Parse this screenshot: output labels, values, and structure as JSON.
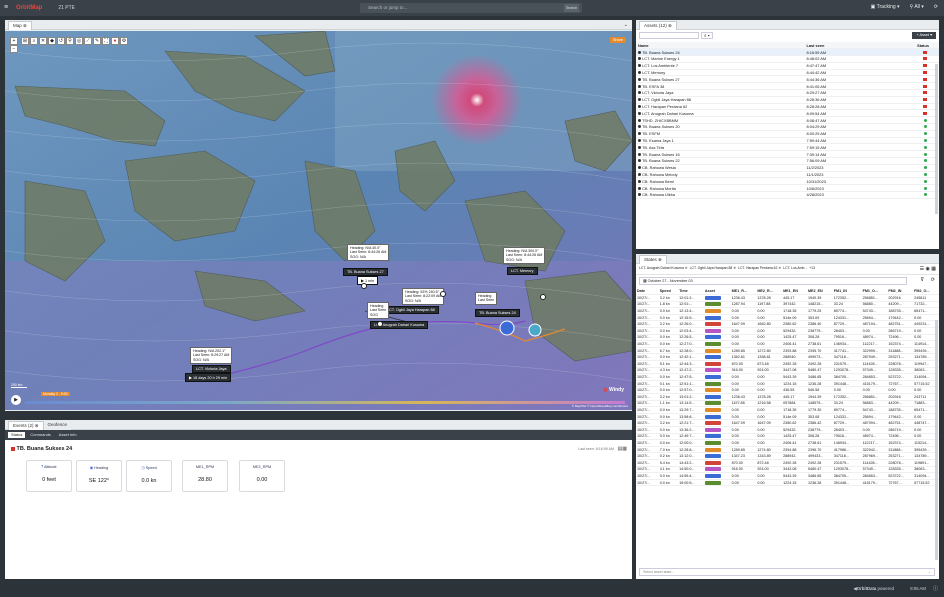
{
  "topbar": {
    "title": "OrbitMap",
    "fleet": "21 PTE",
    "search_placeholder": "Search or jump to...",
    "search_btn": "Search",
    "tracking": "Tracking",
    "all": "All"
  },
  "map": {
    "tab": "Map",
    "share": "Share",
    "windy": "Windy",
    "scale": "250 km",
    "timeline": "Monday 2 - 9:00",
    "attribution": "© MapTiler © OpenStreetMap contributors"
  },
  "callouts": [
    {
      "lines": [
        "Heading: N/A 40.0°",
        "Last Seen: 8:44:26 AM",
        "SOG: N/A"
      ],
      "label": "TB. Buana Sukses 27",
      "eta": "1 min"
    },
    {
      "lines": [
        "Heading: 53% 240.6°",
        "Last Seen: 8:22:09 AM",
        "SOG: N/A"
      ],
      "label": "LCT. Ogbli Jaya Harapan 88"
    },
    {
      "lines": [
        "Heading: N/A 300.0°",
        "Last Seen: 8:44:26 AM",
        "SOG: N/A"
      ],
      "label": "LCT. Memory"
    },
    {
      "lines": [
        "Heading",
        "Last Seen",
        "SOG"
      ],
      "label": "LCT. Anugrah Dahari Kusuma"
    },
    {
      "lines": [
        "Heading",
        "Last Seen"
      ],
      "label": "TB. Buana Sukses 24"
    },
    {
      "lines": [
        "Heading: N/A 202.1°",
        "Last Seen: 8:29:27 AM",
        "SOG: N/A"
      ],
      "label": "LCT. Victoria Jaya",
      "eta": "18 days 20 h 29 min"
    }
  ],
  "assets": {
    "tab": "Assets (12)",
    "add": "Asset",
    "cols": [
      "Name",
      "Last seen",
      "Status"
    ],
    "rows": [
      [
        "TB. Buana Sukses 24",
        "8:16:59 AM",
        "red"
      ],
      [
        "LCT. Marine Energy 1",
        "8:48:02 AM",
        "red"
      ],
      [
        "LCT. Los Ambiente 7",
        "8:47:47 AM",
        "red"
      ],
      [
        "LCT. Memory",
        "8:44:42 AM",
        "red"
      ],
      [
        "TB. Buana Sukses 27",
        "8:44:36 AM",
        "red"
      ],
      [
        "TB. ESFA 38",
        "8:41:05 AM",
        "red"
      ],
      [
        "LCT. Victoria Jaya",
        "8:29:27 AM",
        "red"
      ],
      [
        "LCT. Ogbli Jaya Harapan 88",
        "8:28:36 AM",
        "red"
      ],
      [
        "LCT. Harapan Perdana 62",
        "8:28:28 AM",
        "red"
      ],
      [
        "LCT. Anugrah Dahari Kusuma",
        "8:09:54 AM",
        "red"
      ],
      [
        "TSHD. ZHICXBBMM",
        "8:08:47 AM",
        "green"
      ],
      [
        "TB. Buana Sukses 20",
        "8:04:29 AM",
        "green"
      ],
      [
        "TB. ESFM",
        "8:00:25 AM",
        "green"
      ],
      [
        "TB. Esama Jaya 1",
        "7:59:44 AM",
        "green"
      ],
      [
        "TB. Ass Tirta",
        "7:59:15 AM",
        "green"
      ],
      [
        "TB. Buana Sukses 16",
        "7:39:14 AM",
        "green"
      ],
      [
        "TB. Buana Sukses 22",
        "7:56:09 AM",
        "green"
      ],
      [
        "CB. Rahowa Wesia",
        "11/2/2023",
        "green"
      ],
      [
        "CB. Rahowa Melody",
        "11/1/2023",
        "green"
      ],
      [
        "CB. Rahowa Bemi",
        "10/31/2023",
        "green"
      ],
      [
        "CB. Rahowa Morita",
        "10/6/2023",
        "green"
      ],
      [
        "CB. Rahowa Ulirka",
        "4/28/2023",
        "green"
      ]
    ]
  },
  "states": {
    "tab": "States",
    "chips": [
      "LCT. Anugrah Dahari Kusuma",
      "LCT. Ogbli Jaya Harapan 88",
      "LCT. Harapan Perdana 62",
      "LCT. Los Amb..."
    ],
    "chips_more": "+13",
    "date": "October 27 - November 03",
    "cols": [
      "Date",
      "Speed",
      "Time",
      "Asset",
      "ME1_R...",
      "ME2_R...",
      "ME1_EN",
      "ME2_EN",
      "FM1_IN",
      "FM1_O...",
      "FM2_IN",
      "FM2_O..."
    ],
    "rows": [
      [
        "10/27/...",
        "3.2 kn",
        "12:01:2...",
        "#3b6bd6",
        "1236.43",
        "1378.28",
        "445.17",
        "1940.39",
        "172352...",
        "256851...",
        "202916",
        "245811"
      ],
      [
        "10/27/...",
        "1.8 kn",
        "12:01:...",
        "#5b8c2e",
        "1287.94",
        "1197.88",
        "397442.",
        "148215...",
        "33.24",
        "56880...",
        "44209...",
        "71732..."
      ],
      [
        "10/27/...",
        "0.0 kn",
        "12:13:4...",
        "#e08a2a",
        "0.00",
        "0.00",
        "1718.35",
        "1779.25",
        "89774...",
        "54743...",
        "188735...",
        "65471..."
      ],
      [
        "10/27/...",
        "0.0 kn",
        "12:15:5...",
        "#3b6bd6",
        "0.00",
        "0.00",
        "514e.09",
        "353.09",
        "124331...",
        "25694...",
        "179442...",
        "0.00"
      ],
      [
        "10/27/...",
        "3.2 kn",
        "12:26:0...",
        "#d2443a",
        "1647.09",
        "1662.80",
        "2380.62",
        "2386.40",
        "87729...",
        "487194...",
        "482751...",
        "449231..."
      ],
      [
        "10/27/...",
        "0.0 kn",
        "12:03:4...",
        "#b855c4",
        "0.00",
        "0.00",
        "529432.",
        "238779...",
        "28403...",
        "0.00",
        "286719...",
        "0.00"
      ],
      [
        "10/27/...",
        "0.0 kn",
        "12:26:5...",
        "#3b6bd6",
        "0.00",
        "0.00",
        "1425.47",
        "308.28",
        "79516...",
        "48974...",
        "72496...",
        "0.00"
      ],
      [
        "10/27/...",
        "0.0 kn",
        "12:27:0...",
        "#5b8c2e",
        "0.00",
        "0.00",
        "2406.41",
        "2738.61",
        "146934...",
        "112217...",
        "152374...",
        "114914..."
      ],
      [
        "10/27/...",
        "6.7 kn",
        "12:28:0...",
        "#e08a2a",
        "1289.85",
        "1272.80",
        "2393.88",
        "2395.70",
        "417741...",
        "322999...",
        "311888...",
        "395439..."
      ],
      [
        "10/27/...",
        "0.0 kn",
        "12:42:1...",
        "#3b6bd6",
        "1362.81",
        "1358.81",
        "288940.",
        "499073...",
        "347118...",
        "287949...",
        "253271...",
        "134789..."
      ],
      [
        "10/27/...",
        "5.1 kn",
        "12:44:3...",
        "#d2443a",
        "870.00",
        "873.48",
        "2492.28",
        "2492.28",
        "231579...",
        "114428...",
        "228078...",
        "119947..."
      ],
      [
        "10/27/...",
        "4.3 kn",
        "12:47:2...",
        "#b855c4",
        "916.00",
        "924.00",
        "3447.08",
        "5480.47",
        "1293078...",
        "57349...",
        "128335...",
        "38063..."
      ],
      [
        "10/27/...",
        "0.0 kn",
        "12:47:5...",
        "#3b6bd6",
        "0.00",
        "0.00",
        "5443.39",
        "3486.65",
        "384705...",
        "284653...",
        "523722...",
        "314094..."
      ],
      [
        "10/27/...",
        "0.1 kn",
        "12:51:1...",
        "#5b8c2e",
        "0.00",
        "0.00",
        "1224.15",
        "1236.28",
        "391448...",
        "415179...",
        "72767...",
        "57715.52"
      ],
      [
        "10/27/...",
        "0.0 kn",
        "12:57:0...",
        "#e08a2a",
        "0.00",
        "0.00",
        "436.55",
        "546.58",
        "0.00",
        "0.00",
        "0.00",
        "0.00"
      ],
      [
        "10/27/...",
        "3.2 kn",
        "13:01:2...",
        "#3b6bd6",
        "1236.43",
        "1378.28",
        "445.17",
        "1944.39",
        "172352...",
        "256851...",
        "202916",
        "243711"
      ],
      [
        "10/27/...",
        "1.1 kn",
        "13:14:5...",
        "#5b8c2e",
        "1197.88",
        "1216.58",
        "057884.",
        "148575...",
        "33.24",
        "56863...",
        "44209...",
        "71883..."
      ],
      [
        "10/27/...",
        "0.0 kn",
        "13:29:7...",
        "#e08a2a",
        "0.00",
        "0.00",
        "1718.35",
        "1779.30",
        "89774...",
        "54743...",
        "188735...",
        "65471..."
      ],
      [
        "10/27/...",
        "0.0 kn",
        "13:58:8...",
        "#3b6bd6",
        "0.00",
        "0.00",
        "514e.09",
        "353.08",
        "124331...",
        "25694...",
        "179442...",
        "0.00"
      ],
      [
        "10/27/...",
        "3.2 kn",
        "12:21:7...",
        "#d2443a",
        "1647.09",
        "1647.09",
        "2380.62",
        "2386.42",
        "87729...",
        "487094...",
        "482751...",
        "448747..."
      ],
      [
        "10/27/...",
        "0.0 kn",
        "13:36:2...",
        "#b855c4",
        "0.00",
        "0.00",
        "529432.",
        "238779...",
        "28403...",
        "0.00",
        "286719...",
        "0.00"
      ],
      [
        "10/27/...",
        "0.0 kn",
        "12:49:7...",
        "#3b6bd6",
        "0.00",
        "0.00",
        "1425.47",
        "308.28",
        "79516...",
        "48974...",
        "72496...",
        "0.00"
      ],
      [
        "10/27/...",
        "0.0 kn",
        "12:00:0...",
        "#5b8c2e",
        "0.00",
        "0.00",
        "2406.41",
        "2738.61",
        "146934...",
        "112217...",
        "152374...",
        "115214..."
      ],
      [
        "10/27/...",
        "7.0 kn",
        "12:28:8...",
        "#e08a2a",
        "1289.85",
        "1274.80",
        "2394.88",
        "2396.70",
        "417986...",
        "322942...",
        "311888...",
        "395439..."
      ],
      [
        "10/27/...",
        "0.2 kn",
        "13:12:0...",
        "#3b6bd6",
        "1347.23",
        "1343.89",
        "288942.",
        "499433...",
        "347118...",
        "287969...",
        "253271...",
        "134789..."
      ],
      [
        "10/27/...",
        "5.4 kn",
        "14:43:2...",
        "#d2443a",
        "870.00",
        "872.48",
        "2492.28",
        "2492.28",
        "231579...",
        "114428...",
        "228078...",
        "119891..."
      ],
      [
        "10/27/...",
        "4.1 kn",
        "14:50:0...",
        "#b855c4",
        "916.00",
        "924.00",
        "3443.08",
        "5480.47",
        "1293078...",
        "57349...",
        "128335...",
        "38063..."
      ],
      [
        "10/27/...",
        "0.0 kn",
        "14:55:4...",
        "#3b6bd6",
        "0.00",
        "0.00",
        "5443.39",
        "3486.65",
        "384705...",
        "284653...",
        "523722...",
        "314094..."
      ],
      [
        "10/27/...",
        "0.0 kn",
        "15:00:5...",
        "#5b8c2e",
        "0.00",
        "0.00",
        "1224.15",
        "1236.28",
        "391448...",
        "415179...",
        "72767...",
        "57715.52"
      ]
    ],
    "footer_select": "Select asset state..."
  },
  "events": {
    "tabs": [
      "Events (2)",
      "Geofence"
    ],
    "subtabs": [
      "Status",
      "Commands",
      "Asset Info"
    ],
    "vessel": "TB. Buana Sukses 24",
    "last_seen": "Last seen: 8:16:59 AM",
    "cards": [
      {
        "icon": "altitude-icon",
        "label": "Altitude",
        "value": "0 feet"
      },
      {
        "icon": "heading-icon",
        "label": "Heading",
        "value": "SE 122°"
      },
      {
        "icon": "speed-icon",
        "label": "Speed",
        "value": "0.0 kn"
      },
      {
        "icon": "",
        "label": "ME1_RPM",
        "value": "28.80"
      },
      {
        "icon": "",
        "label": "ME2_RPM",
        "value": "0.00"
      }
    ]
  },
  "bottombar": {
    "brand": "OrbitData",
    "powered": "powered",
    "time": "8:55 AM"
  }
}
